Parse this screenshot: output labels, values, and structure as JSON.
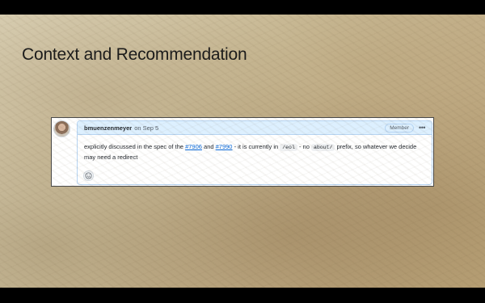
{
  "slide": {
    "title": "Context and Recommendation"
  },
  "comment": {
    "author": "bmuenzenmeyer",
    "date_text": "on Sep 5",
    "role_badge": "Member",
    "more_icon": "kebab-horizontal-icon",
    "body": {
      "part1": "explicitly discussed in the spec of the ",
      "link1": "#7906",
      "part2": " and ",
      "link2": "#7990",
      "part3": " - it is currently in ",
      "code1": "/eol",
      "part4": " - no ",
      "code2": "about/",
      "part5": " prefix, so whatever we decide may need a redirect"
    },
    "reaction_icon": "smiley-icon"
  },
  "colors": {
    "header_bg": "#ddf0ff",
    "border_blue": "#b6d4f2",
    "link": "#0969da"
  }
}
